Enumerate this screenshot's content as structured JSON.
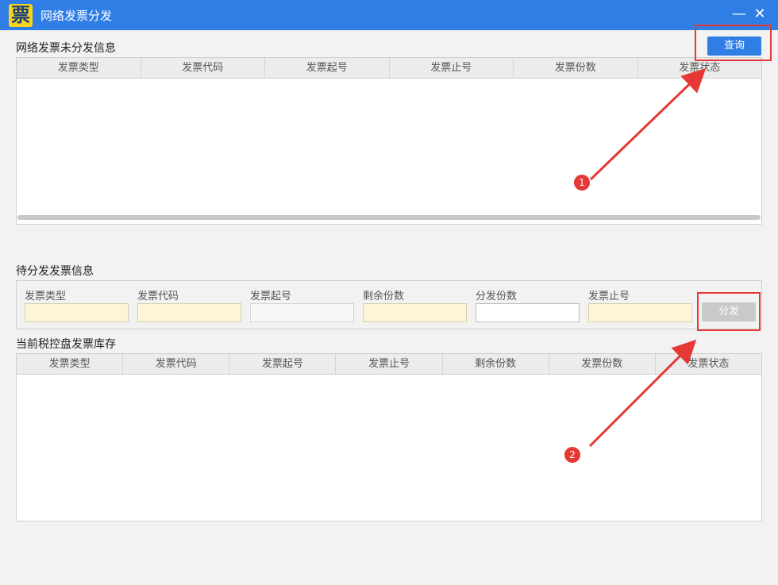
{
  "window": {
    "logo_glyph": "票",
    "title": "网络发票分发",
    "minimize_glyph": "—",
    "close_glyph": "✕"
  },
  "undistributed": {
    "title": "网络发票未分发信息",
    "query_label": "查询",
    "columns": [
      "发票类型",
      "发票代码",
      "发票起号",
      "发票止号",
      "发票份数",
      "发票状态"
    ],
    "rows": []
  },
  "pending": {
    "title": "待分发发票信息",
    "fields": [
      {
        "label": "发票类型",
        "value": ""
      },
      {
        "label": "发票代码",
        "value": ""
      },
      {
        "label": "发票起号",
        "value": ""
      },
      {
        "label": "剩余份数",
        "value": ""
      },
      {
        "label": "分发份数",
        "value": ""
      },
      {
        "label": "发票止号",
        "value": ""
      }
    ],
    "distribute_label": "分发"
  },
  "inventory": {
    "title": "当前税控盘发票库存",
    "columns": [
      "发票类型",
      "发票代码",
      "发票起号",
      "发票止号",
      "剩余份数",
      "发票份数",
      "发票状态"
    ],
    "rows": []
  },
  "annotations": {
    "marker_1": "1",
    "marker_2": "2",
    "accent_color": "#e53935"
  },
  "theme": {
    "titlebar": "#2f7ee6",
    "primary_button": "#2f7ee6",
    "disabled_button": "#c9c9c9",
    "readonly_field": "#fdf5d8"
  }
}
